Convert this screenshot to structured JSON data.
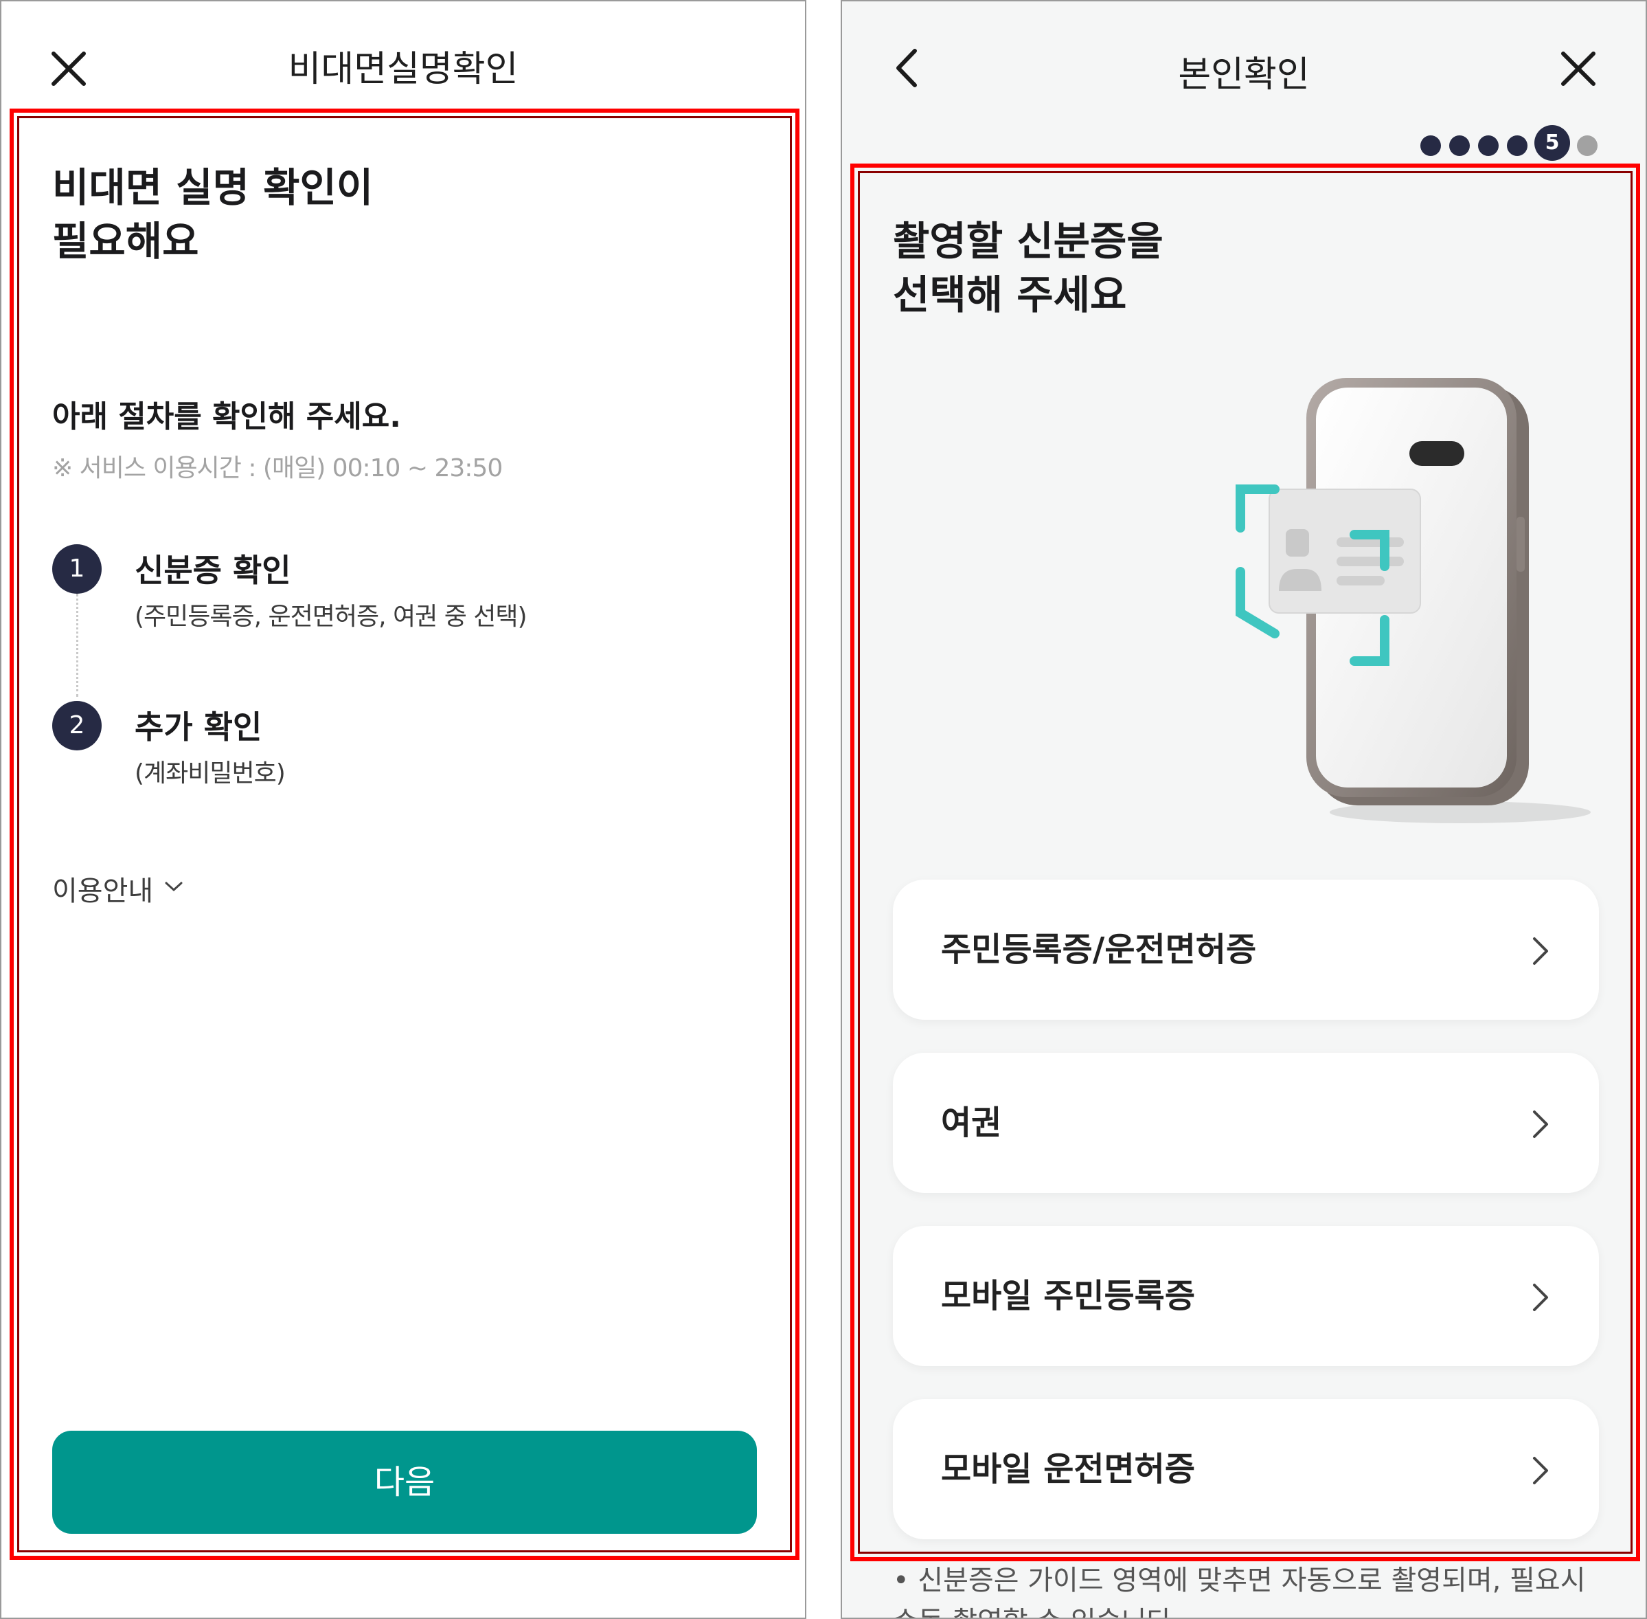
{
  "left_screen": {
    "header": {
      "title": "비대면실명확인",
      "close_icon": "close-icon"
    },
    "headline": [
      "비대면 실명 확인이",
      "필요해요"
    ],
    "procedure_title": "아래 절차를 확인해 주세요.",
    "service_hours": "※ 서비스 이용시간 : (매일) 00:10 ~ 23:50",
    "steps": [
      {
        "number": "1",
        "title": "신분증 확인",
        "desc": "(주민등록증, 운전면허증, 여권 중 선택)"
      },
      {
        "number": "2",
        "title": "추가 확인",
        "desc": "(계좌비밀번호)"
      }
    ],
    "guide_label": "이용안내",
    "next_button": "다음",
    "colors": {
      "accent": "#00968d",
      "step_circle": "#262a44",
      "highlight": "#ff0000"
    }
  },
  "right_screen": {
    "header": {
      "title": "본인확인",
      "back_icon": "chevron-left-icon",
      "close_icon": "close-icon"
    },
    "progress": {
      "current": "5",
      "total_steps": 6
    },
    "headline": [
      "촬영할 신분증을",
      "선택해 주세요"
    ],
    "options": [
      {
        "label": "주민등록증/운전면허증"
      },
      {
        "label": "여권"
      },
      {
        "label": "모바일 주민등록증"
      },
      {
        "label": "모바일 운전면허증"
      }
    ],
    "footnote": [
      "• 신분증은 가이드 영역에 맞추면 자동으로 촬영되며, 필요시",
      "  수동 촬영할 수 있습니다"
    ],
    "illustration_icon": "phone-id-scan-illustration",
    "colors": {
      "background": "#f5f6f6",
      "scan_frame": "#3fc6c0",
      "highlight": "#ff0000"
    }
  }
}
